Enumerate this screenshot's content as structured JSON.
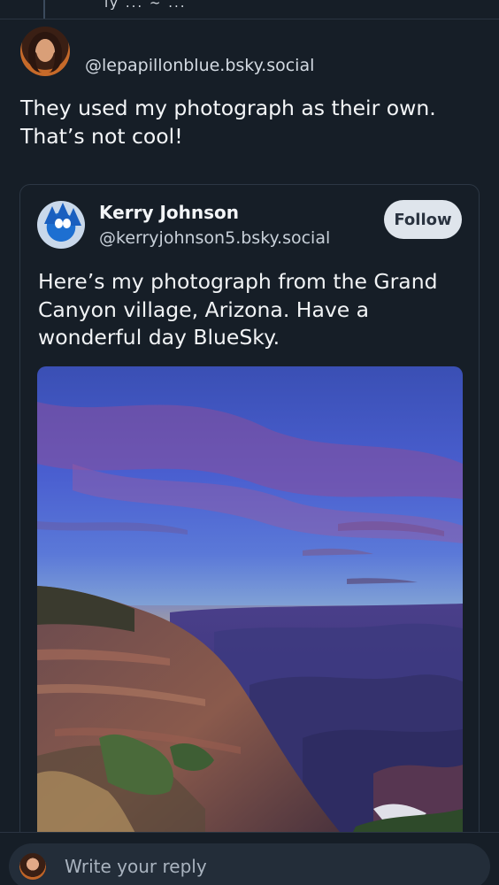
{
  "top_strip": {
    "partial_name": "ly ... ~ ..."
  },
  "post": {
    "handle": "@lepapillonblue.bsky.social",
    "text": "They used my photograph as their own. That’s not cool!"
  },
  "quoted_post": {
    "display_name": "Kerry Johnson",
    "handle": "@kerryjohnson5.bsky.social",
    "follow_label": "Follow",
    "text": "Here’s my photograph from the Grand Canyon village, Arizona. Have a wonderful day BlueSky."
  },
  "reply": {
    "placeholder": "Write your reply"
  },
  "colors": {
    "background": "#161e27",
    "follow_button": "#dfe5ec",
    "reply_field": "#232d39"
  }
}
